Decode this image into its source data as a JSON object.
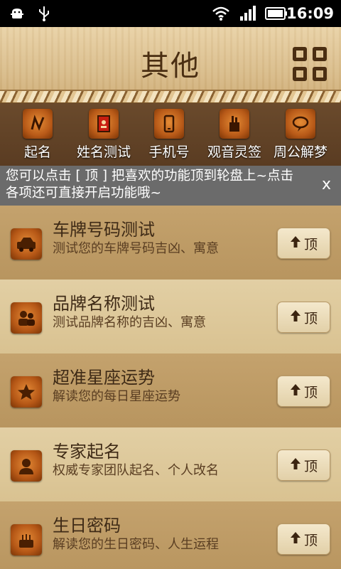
{
  "status_bar": {
    "time": "16:09",
    "icons": [
      "android-debug-icon",
      "usb-icon",
      "wifi-icon",
      "signal-icon",
      "battery-icon"
    ]
  },
  "header": {
    "title": "其他",
    "menu_icon": "grid-icon"
  },
  "quick_bar": {
    "items": [
      {
        "label": "起名"
      },
      {
        "label": "姓名测试"
      },
      {
        "label": "手机号"
      },
      {
        "label": "观音灵签"
      },
      {
        "label": "周公解梦"
      }
    ]
  },
  "notice": {
    "text": "您可以点击 [ 顶 ] 把喜欢的功能顶到轮盘上~点击各项还可直接开启功能哦~",
    "close": "x"
  },
  "list": {
    "top_label": "顶",
    "items": [
      {
        "title": "车牌号码测试",
        "subtitle": "测试您的车牌号码吉凶、寓意"
      },
      {
        "title": "品牌名称测试",
        "subtitle": "测试品牌名称的吉凶、寓意"
      },
      {
        "title": "超准星座运势",
        "subtitle": "解读您的每日星座运势"
      },
      {
        "title": "专家起名",
        "subtitle": "权威专家团队起名、个人改名"
      },
      {
        "title": "生日密码",
        "subtitle": "解读您的生日密码、人生运程"
      }
    ]
  }
}
